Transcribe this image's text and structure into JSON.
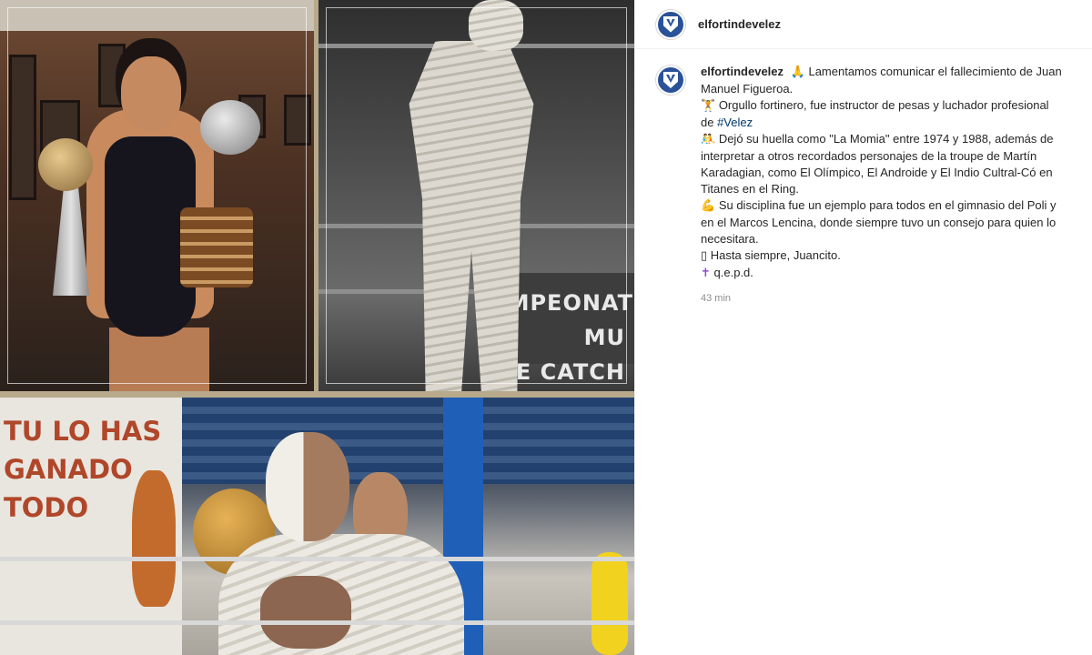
{
  "post": {
    "username": "elfortindevelez",
    "caption": {
      "line1_emoji": "🙏",
      "line1_text": "Lamentamos comunicar el fallecimiento de Juan Manuel Figueroa.",
      "p2_emoji": "🏋",
      "p2_text": "Orgullo fortinero, fue instructor de pesas y luchador profesional de ",
      "hashtag": "#Velez",
      "p3_emoji": "🤼",
      "p3_text": "Dejó su huella como \"La Momia\" entre 1974 y 1988, además de interpretar a otros recordados personajes de la troupe de Martín Karadagian, como El Olímpico, El Androide y El Indio Cultral-Có en Titanes en el Ring.",
      "p4_emoji": "💪",
      "p4_text": "Su disciplina fue un ejemplo para todos en el gimnasio del Poli y en el Marcos Lencina, donde siempre tuvo un consejo para quien lo necesitara.",
      "p5_emoji": "▯",
      "p5_text": "Hasta siempre, Juancito.",
      "p6_emoji": "✝",
      "p6_text": "q.e.p.d."
    },
    "timestamp": "43 min"
  },
  "media": {
    "photo1_label": "wrestler-with-trophies",
    "photo2_label": "la-momia-in-ring",
    "photo2_banner": "AMPEONATO MU\nE CATCH",
    "photo3_label": "la-momia-gym",
    "photo3_wall_text": "TU LO HAS\nGANADO TODO"
  },
  "colors": {
    "accent_avatar": "#2a5298",
    "hashtag": "#00376b",
    "muted": "#8e8e8e",
    "collage_border": "#b8a98b"
  }
}
